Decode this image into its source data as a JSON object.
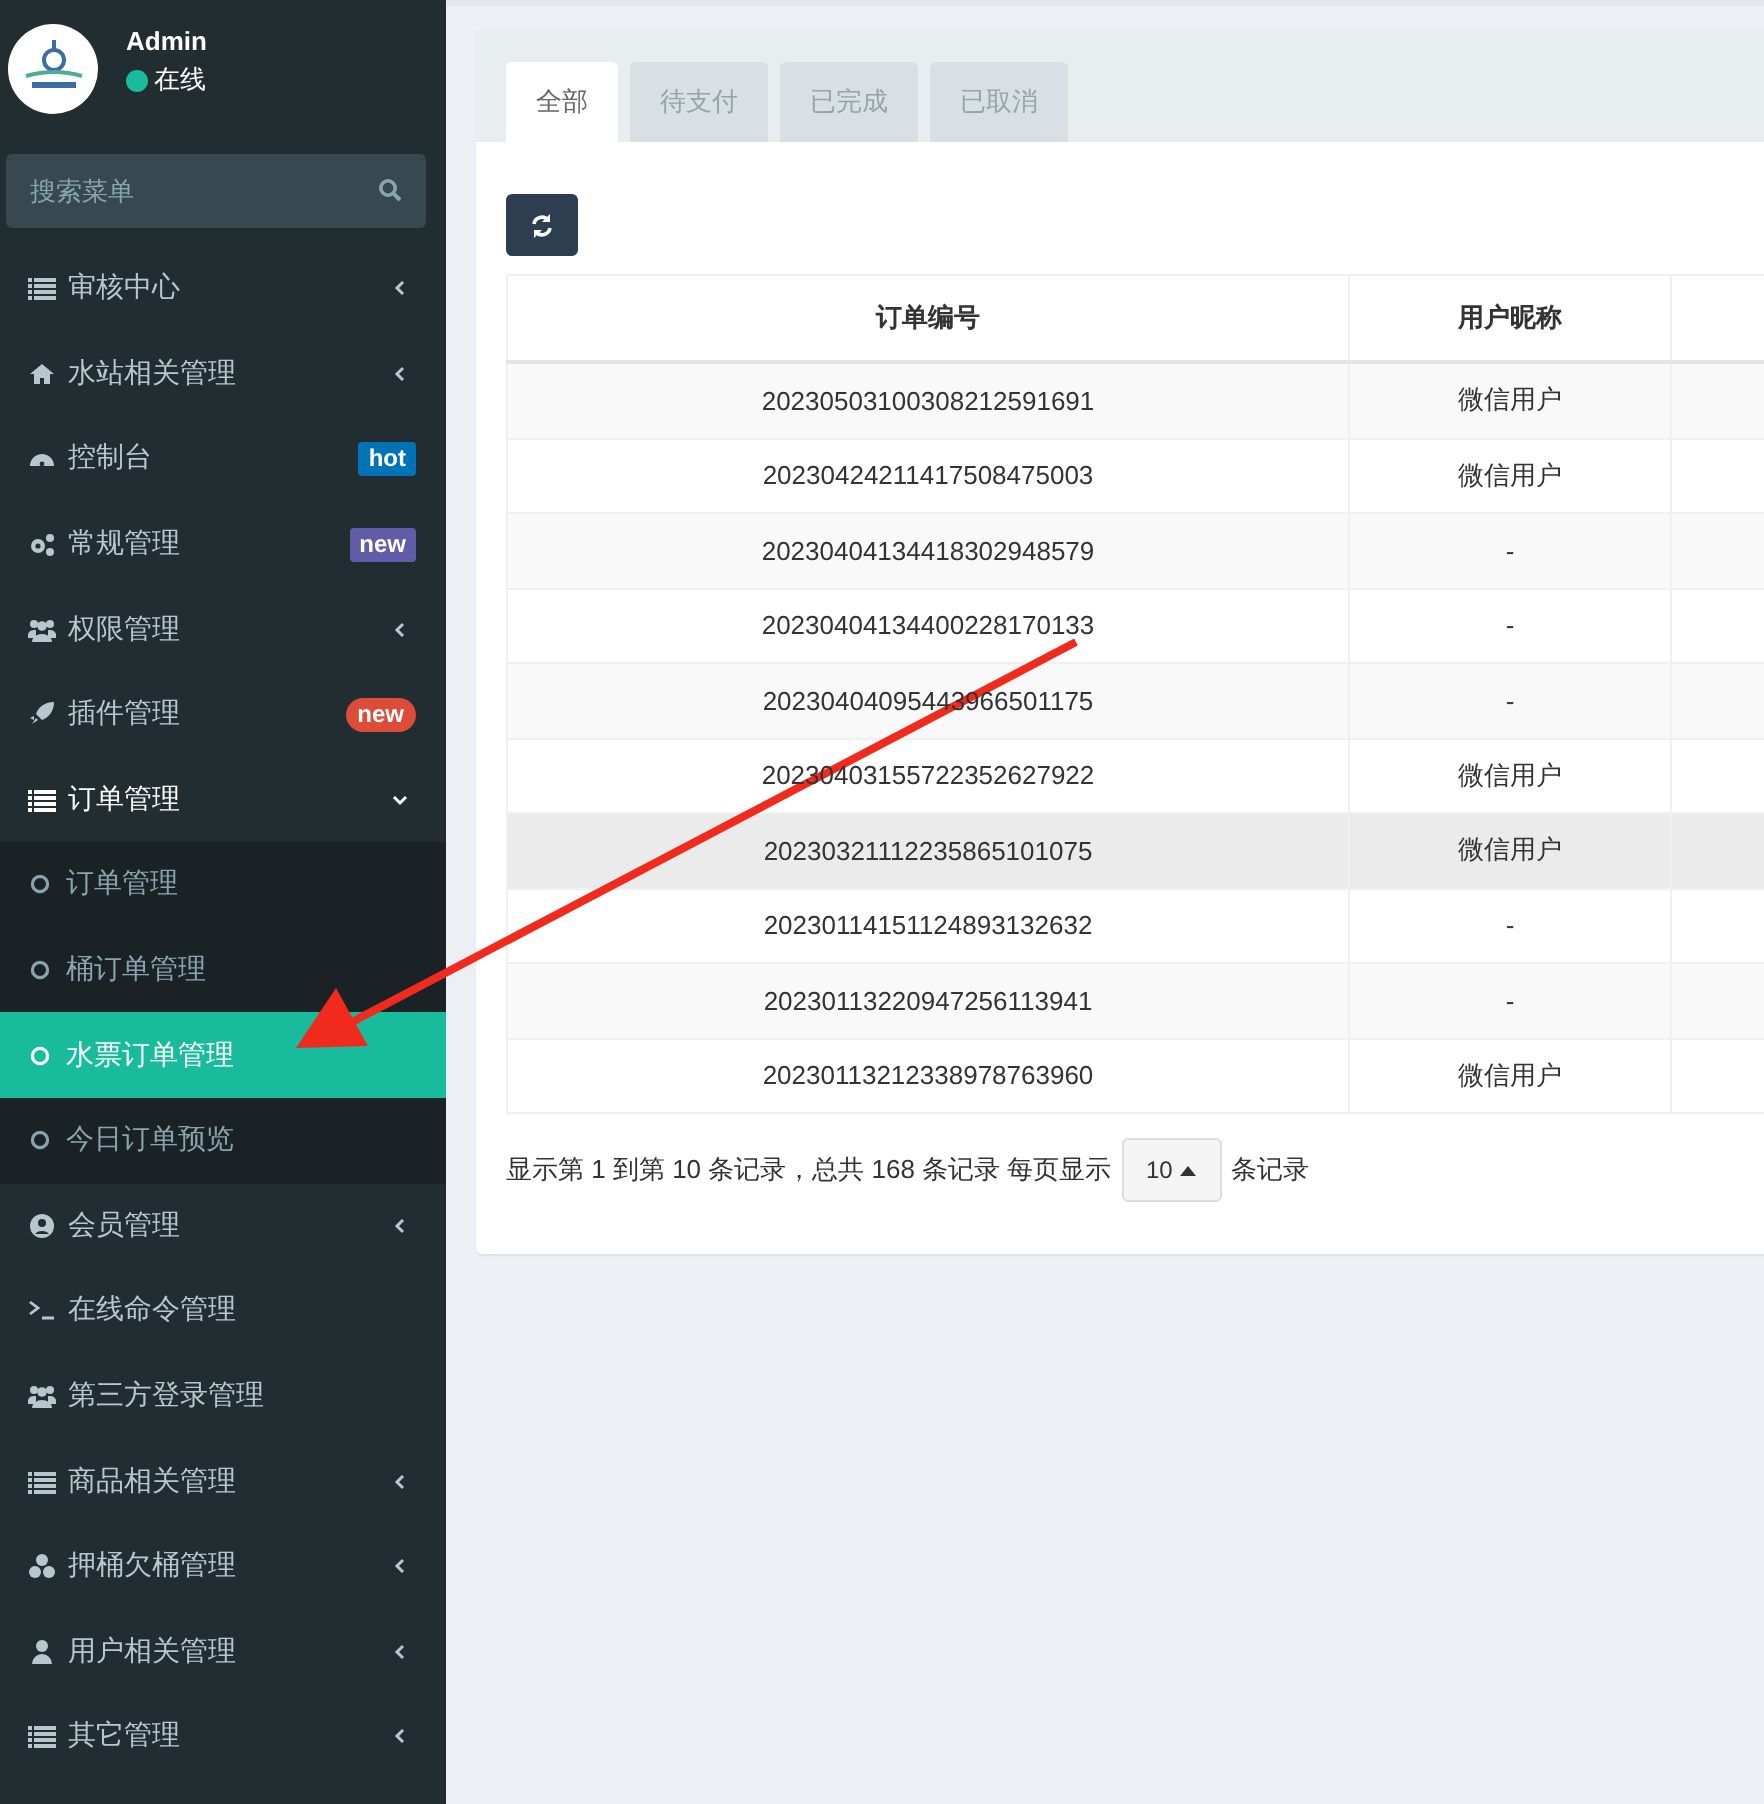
{
  "user": {
    "name": "Admin",
    "status": "在线",
    "online": true
  },
  "search": {
    "placeholder": "搜索菜单"
  },
  "menu": [
    {
      "label": "审核中心",
      "selected": false,
      "expanded": false
    },
    {
      "label": "水站相关管理",
      "selected": false,
      "expanded": false
    },
    {
      "label": "控制台",
      "selected": false,
      "badge": {
        "text": "hot",
        "color": "#0073b7",
        "kind": "label"
      }
    },
    {
      "label": "常规管理",
      "selected": false,
      "badge": {
        "text": "new",
        "color": "#605ca8",
        "kind": "label"
      }
    },
    {
      "label": "权限管理",
      "selected": false,
      "expanded": false
    },
    {
      "label": "插件管理",
      "selected": false,
      "badge": {
        "text": "new",
        "color": "#dd4b39",
        "kind": "pill"
      }
    },
    {
      "label": "订单管理",
      "selected": true,
      "expanded": true,
      "children": [
        {
          "label": "订单管理",
          "selected": false
        },
        {
          "label": "桶订单管理",
          "selected": false
        },
        {
          "label": "水票订单管理",
          "selected": true
        },
        {
          "label": "今日订单预览",
          "selected": false
        }
      ]
    },
    {
      "label": "会员管理",
      "selected": false,
      "expanded": false
    },
    {
      "label": "在线命令管理",
      "selected": false
    },
    {
      "label": "第三方登录管理",
      "selected": false
    },
    {
      "label": "商品相关管理",
      "selected": false,
      "expanded": false
    },
    {
      "label": "押桶欠桶管理",
      "selected": false,
      "expanded": false
    },
    {
      "label": "用户相关管理",
      "selected": false,
      "expanded": false
    },
    {
      "label": "其它管理",
      "selected": false,
      "expanded": false
    }
  ],
  "tabs": [
    {
      "label": "全部",
      "selected": true
    },
    {
      "label": "待支付",
      "selected": false
    },
    {
      "label": "已完成",
      "selected": false
    },
    {
      "label": "已取消",
      "selected": false
    }
  ],
  "table": {
    "columns": [
      "订单编号",
      "用户昵称"
    ],
    "rows": [
      {
        "cells": [
          "20230503100308212591691",
          "微信用户"
        ],
        "hovered": false
      },
      {
        "cells": [
          "20230424211417508475003",
          "微信用户"
        ],
        "hovered": false
      },
      {
        "cells": [
          "20230404134418302948579",
          "-"
        ],
        "hovered": false
      },
      {
        "cells": [
          "20230404134400228170133",
          "-"
        ],
        "hovered": false
      },
      {
        "cells": [
          "20230404095443966501175",
          "-"
        ],
        "hovered": false
      },
      {
        "cells": [
          "20230403155722352627922",
          "微信用户"
        ],
        "hovered": false
      },
      {
        "cells": [
          "20230321112235865101075",
          "微信用户"
        ],
        "hovered": true
      },
      {
        "cells": [
          "20230114151124893132632",
          "-"
        ],
        "hovered": false
      },
      {
        "cells": [
          "20230113220947256113941",
          "-"
        ],
        "hovered": false
      },
      {
        "cells": [
          "20230113212338978763960",
          "微信用户"
        ],
        "hovered": false
      }
    ]
  },
  "pagination": {
    "summary": "显示第 1 到第 10 条记录，总共 168 条记录 每页显示",
    "page_size": "10",
    "suffix": "条记录"
  }
}
